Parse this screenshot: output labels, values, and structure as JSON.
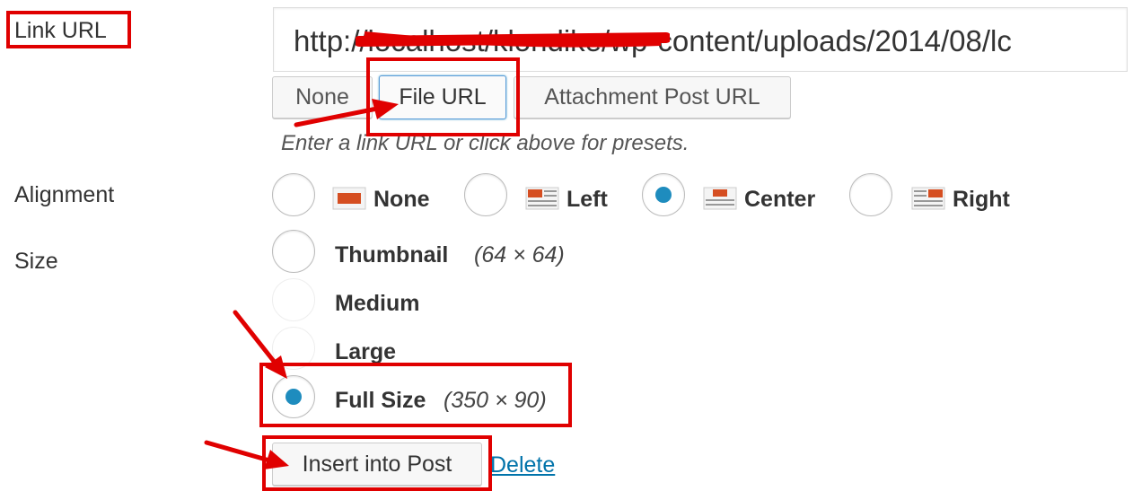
{
  "link_url": {
    "label": "Link URL",
    "value": "http://localhost/klondike/wp-content/uploads/2014/08/lc",
    "buttons": [
      "None",
      "File URL",
      "Attachment Post URL"
    ],
    "active_button": "File URL",
    "hint": "Enter a link URL or click above for presets."
  },
  "alignment": {
    "label": "Alignment",
    "options": [
      "None",
      "Left",
      "Center",
      "Right"
    ],
    "selected": "Center"
  },
  "size": {
    "label": "Size",
    "options": [
      {
        "label": "Thumbnail",
        "dims": "(64 × 64)"
      },
      {
        "label": "Medium",
        "dims": ""
      },
      {
        "label": "Large",
        "dims": ""
      },
      {
        "label": "Full Size",
        "dims": "(350 × 90)"
      }
    ],
    "selected": "Full Size"
  },
  "actions": {
    "insert_label": "Insert into Post",
    "delete_label": "Delete"
  },
  "colors": {
    "accent": "#1e8cbe",
    "annotation": "#e00000",
    "icon_orange": "#d54e21"
  }
}
